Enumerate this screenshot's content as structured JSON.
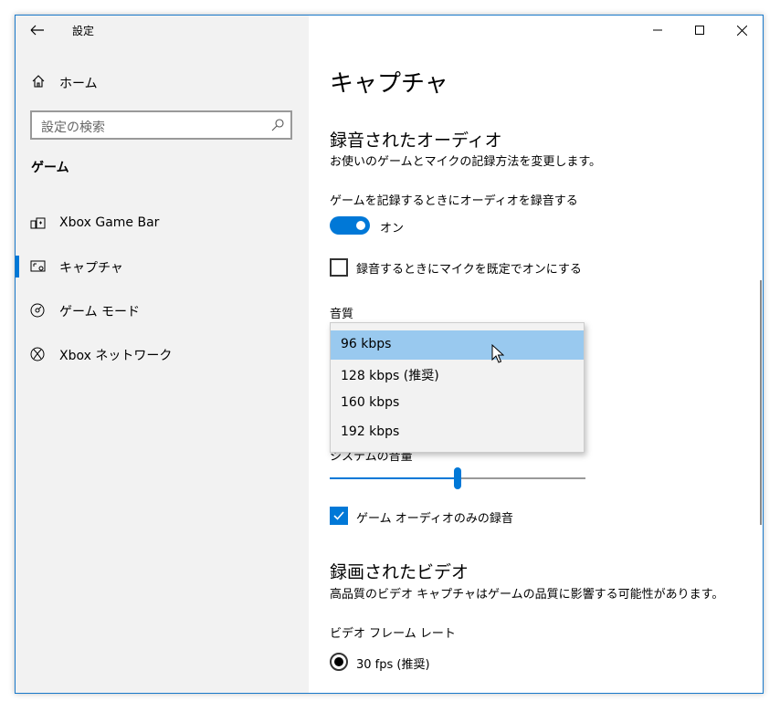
{
  "window": {
    "title": "設定",
    "controls": {
      "minimize": "minimize",
      "maximize": "maximize",
      "close": "close"
    }
  },
  "sidebar": {
    "home_label": "ホーム",
    "search_placeholder": "設定の検索",
    "section_title": "ゲーム",
    "items": [
      {
        "label": "Xbox Game Bar",
        "icon": "game-bar-icon",
        "selected": false
      },
      {
        "label": "キャプチャ",
        "icon": "capture-icon",
        "selected": true
      },
      {
        "label": "ゲーム モード",
        "icon": "game-mode-icon",
        "selected": false
      },
      {
        "label": "Xbox ネットワーク",
        "icon": "xbox-icon",
        "selected": false
      }
    ]
  },
  "main": {
    "page_title": "キャプチャ",
    "audio": {
      "heading": "録音されたオーディオ",
      "description": "お使いのゲームとマイクの記録方法を変更します。",
      "record_audio_label": "ゲームを記録するときにオーディオを録音する",
      "toggle_state": "オン",
      "mic_default_label": "録音するときにマイクを既定でオンにする",
      "mic_default_checked": false,
      "quality_label": "音質",
      "quality_options": [
        {
          "label": "96 kbps",
          "selected": true
        },
        {
          "label": "128 kbps (推奨)",
          "selected": false
        },
        {
          "label": "160 kbps",
          "selected": false
        },
        {
          "label": "192 kbps",
          "selected": false
        }
      ],
      "system_volume_label": "システムの音量",
      "system_volume_value": 0.5,
      "game_audio_only_label": "ゲーム オーディオのみの録音",
      "game_audio_only_checked": true
    },
    "video": {
      "heading": "録画されたビデオ",
      "description": "高品質のビデオ キャプチャはゲームの品質に影響する可能性があります。",
      "frame_rate_label": "ビデオ フレーム レート",
      "frame_rate_option": "30 fps (推奨)",
      "frame_rate_selected": true
    }
  },
  "colors": {
    "accent": "#0078d7",
    "sidebar_bg": "#f2f2f2",
    "highlight": "#99c9ef"
  }
}
